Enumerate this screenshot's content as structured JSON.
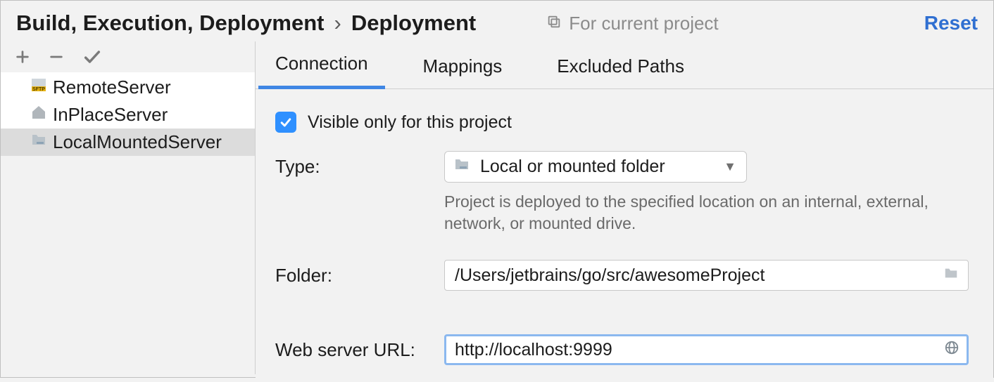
{
  "breadcrumb": {
    "root": "Build, Execution, Deployment",
    "current": "Deployment"
  },
  "header": {
    "for_project": "For current project",
    "reset": "Reset"
  },
  "toolbar": {
    "add_icon": "plus-icon",
    "remove_icon": "minus-icon",
    "apply_icon": "checkmark-icon"
  },
  "servers": [
    {
      "name": "RemoteServer",
      "kind": "sftp",
      "selected": false
    },
    {
      "name": "InPlaceServer",
      "kind": "inplace",
      "selected": false
    },
    {
      "name": "LocalMountedServer",
      "kind": "local",
      "selected": true
    }
  ],
  "tabs": {
    "connection": "Connection",
    "mappings": "Mappings",
    "excluded": "Excluded Paths",
    "active": "connection"
  },
  "form": {
    "visible_label": "Visible only for this project",
    "visible_checked": true,
    "type": {
      "label": "Type:",
      "value": "Local or mounted folder",
      "hint": "Project is deployed to the specified location on an internal, external, network, or mounted drive."
    },
    "folder": {
      "label": "Folder:",
      "value": "/Users/jetbrains/go/src/awesomeProject"
    },
    "web_url": {
      "label": "Web server URL:",
      "value": "http://localhost:9999"
    }
  }
}
